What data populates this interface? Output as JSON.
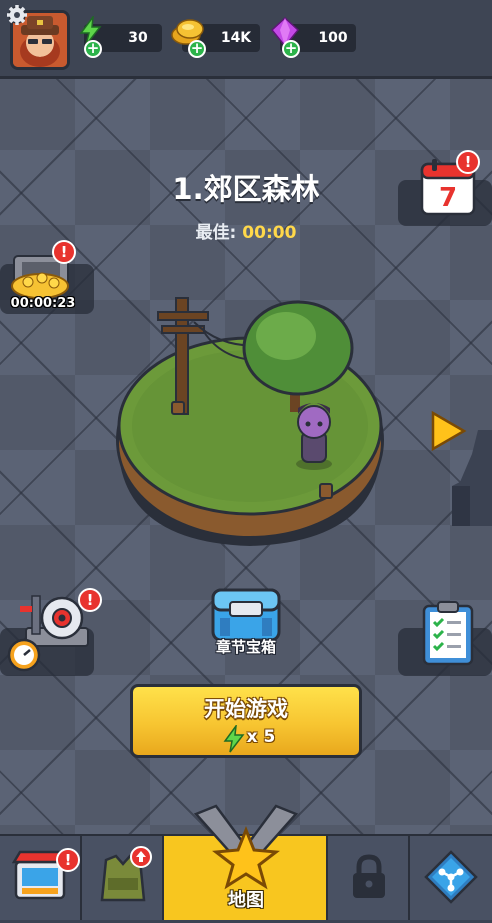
{
  "resources": {
    "energy": "30",
    "gold": "14K",
    "gems": "100"
  },
  "level": {
    "title": "1.郊区森林",
    "best_label": "最佳:",
    "best_value": "00:00"
  },
  "side": {
    "treasure_timer": "00:00:23",
    "badge_mark": "!"
  },
  "chapter_chest": {
    "label": "章节宝箱"
  },
  "start": {
    "label": "开始游戏",
    "cost": "x 5"
  },
  "tabs": {
    "shop": "shop-icon",
    "equipment": "vest-icon",
    "map_label": "地图",
    "locked": "lock-icon",
    "talent": "network-icon"
  },
  "colors": {
    "accent_yellow": "#f8c61f",
    "energy_green": "#5ed64a",
    "gold": "#f6c233",
    "gem_purple": "#c349e6",
    "badge_red": "#e8332e"
  }
}
